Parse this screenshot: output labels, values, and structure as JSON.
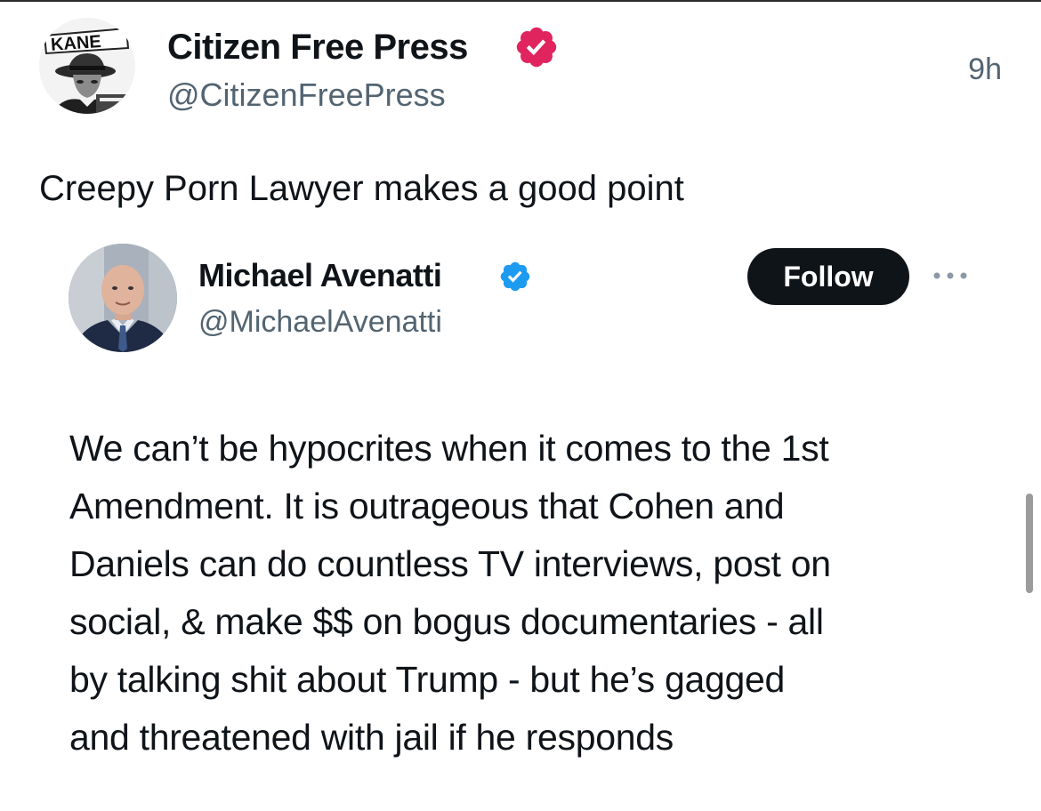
{
  "post": {
    "author": {
      "name": "Citizen Free Press",
      "handle": "@CitizenFreePress",
      "avatar_text": "KANE",
      "badge": "verified-badge-icon",
      "badge_color": "#e0245e"
    },
    "time": "9h",
    "text": "Creepy Porn Lawyer makes a good point"
  },
  "quoted": {
    "author": {
      "name": "Michael Avenatti",
      "handle": "@MichaelAvenatti",
      "badge": "verified-badge-icon",
      "badge_color": "#1d9bf0"
    },
    "follow_label": "Follow",
    "more_icon": "more-options-icon",
    "text_lines": [
      "We can’t be hypocrites when it comes to the 1st",
      "Amendment. It is outrageous that Cohen and",
      "Daniels can do countless TV interviews, post on",
      "social, & make $$ on bogus documentaries - all",
      "by talking shit about Trump - but he’s gagged",
      "and threatened with jail if he responds"
    ]
  }
}
